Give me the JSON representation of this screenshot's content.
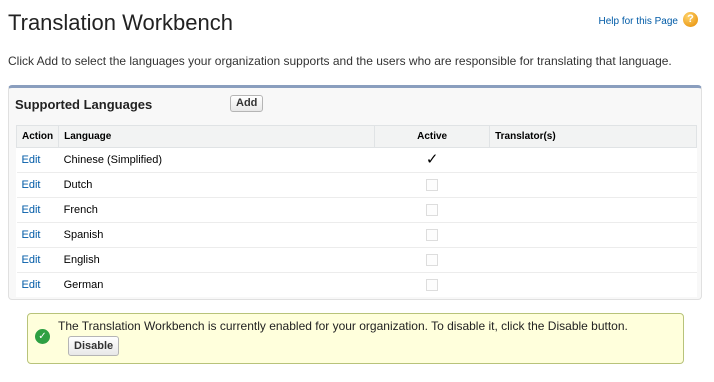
{
  "header": {
    "title": "Translation Workbench",
    "help_link": "Help for this Page",
    "help_icon": "question-mark-icon"
  },
  "intro": "Click Add to select the languages your organization supports and the users who are responsible for translating that language.",
  "panel": {
    "title": "Supported Languages",
    "add_label": "Add",
    "accent_color": "#8a9ebe",
    "columns": [
      "Action",
      "Language",
      "Active",
      "Translator(s)"
    ],
    "rows": [
      {
        "action": "Edit",
        "language": "Chinese (Simplified)",
        "active": true,
        "translators": ""
      },
      {
        "action": "Edit",
        "language": "Dutch",
        "active": false,
        "translators": ""
      },
      {
        "action": "Edit",
        "language": "French",
        "active": false,
        "translators": ""
      },
      {
        "action": "Edit",
        "language": "Spanish",
        "active": false,
        "translators": ""
      },
      {
        "action": "Edit",
        "language": "English",
        "active": false,
        "translators": ""
      },
      {
        "action": "Edit",
        "language": "German",
        "active": false,
        "translators": ""
      }
    ]
  },
  "message": {
    "text": "The Translation Workbench is currently enabled for your organization. To disable it, click the Disable button.",
    "button_label": "Disable",
    "icon": "check-circle-icon",
    "background_color": "#ffffdc"
  }
}
